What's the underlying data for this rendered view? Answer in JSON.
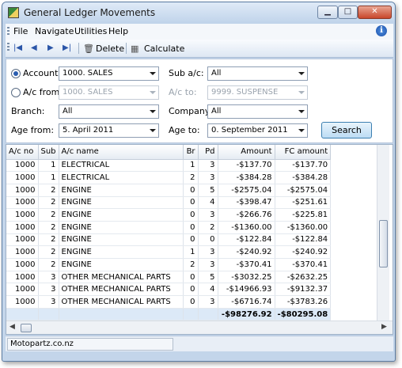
{
  "window": {
    "title": "General Ledger Movements"
  },
  "menu": [
    "File",
    "Navigate",
    "Utilities",
    "Help"
  ],
  "toolbar": {
    "delete": "Delete",
    "calculate": "Calculate"
  },
  "form": {
    "account_label": "Account:",
    "account_value": "1000. SALES",
    "acfrom_label": "A/c from:",
    "acfrom_value": "1000. SALES",
    "branch_label": "Branch:",
    "branch_value": "All",
    "agefrom_label": "Age from:",
    "agefrom_value": "5. April 2011",
    "subac_label": "Sub a/c:",
    "subac_value": "All",
    "acto_label": "A/c to:",
    "acto_value": "9999. SUSPENSE",
    "company_label": "Company:",
    "company_value": "All",
    "ageto_label": "Age to:",
    "ageto_value": "0. September 2011",
    "search": "Search"
  },
  "grid": {
    "columns": [
      "A/c no",
      "Sub",
      "A/c name",
      "Br",
      "Pd",
      "Amount",
      "FC amount"
    ],
    "rows": [
      [
        "1000",
        "1",
        "ELECTRICAL",
        "1",
        "3",
        "-$137.70",
        "-$137.70"
      ],
      [
        "1000",
        "1",
        "ELECTRICAL",
        "2",
        "3",
        "-$384.28",
        "-$384.28"
      ],
      [
        "1000",
        "2",
        "ENGINE",
        "0",
        "5",
        "-$2575.04",
        "-$2575.04"
      ],
      [
        "1000",
        "2",
        "ENGINE",
        "0",
        "4",
        "-$398.47",
        "-$251.61"
      ],
      [
        "1000",
        "2",
        "ENGINE",
        "0",
        "3",
        "-$266.76",
        "-$225.81"
      ],
      [
        "1000",
        "2",
        "ENGINE",
        "0",
        "2",
        "-$1360.00",
        "-$1360.00"
      ],
      [
        "1000",
        "2",
        "ENGINE",
        "0",
        "0",
        "-$122.84",
        "-$122.84"
      ],
      [
        "1000",
        "2",
        "ENGINE",
        "1",
        "3",
        "-$240.92",
        "-$240.92"
      ],
      [
        "1000",
        "2",
        "ENGINE",
        "2",
        "3",
        "-$370.41",
        "-$370.41"
      ],
      [
        "1000",
        "3",
        "OTHER MECHANICAL PARTS",
        "0",
        "5",
        "-$3032.25",
        "-$2632.25"
      ],
      [
        "1000",
        "3",
        "OTHER MECHANICAL PARTS",
        "0",
        "4",
        "-$14966.93",
        "-$9132.37"
      ],
      [
        "1000",
        "3",
        "OTHER MECHANICAL PARTS",
        "0",
        "3",
        "-$6716.74",
        "-$3783.26"
      ]
    ],
    "total_amount": "-$98276.92",
    "total_fc_amount": "-$80295.08"
  },
  "status": {
    "company": "Motopartz.co.nz"
  }
}
